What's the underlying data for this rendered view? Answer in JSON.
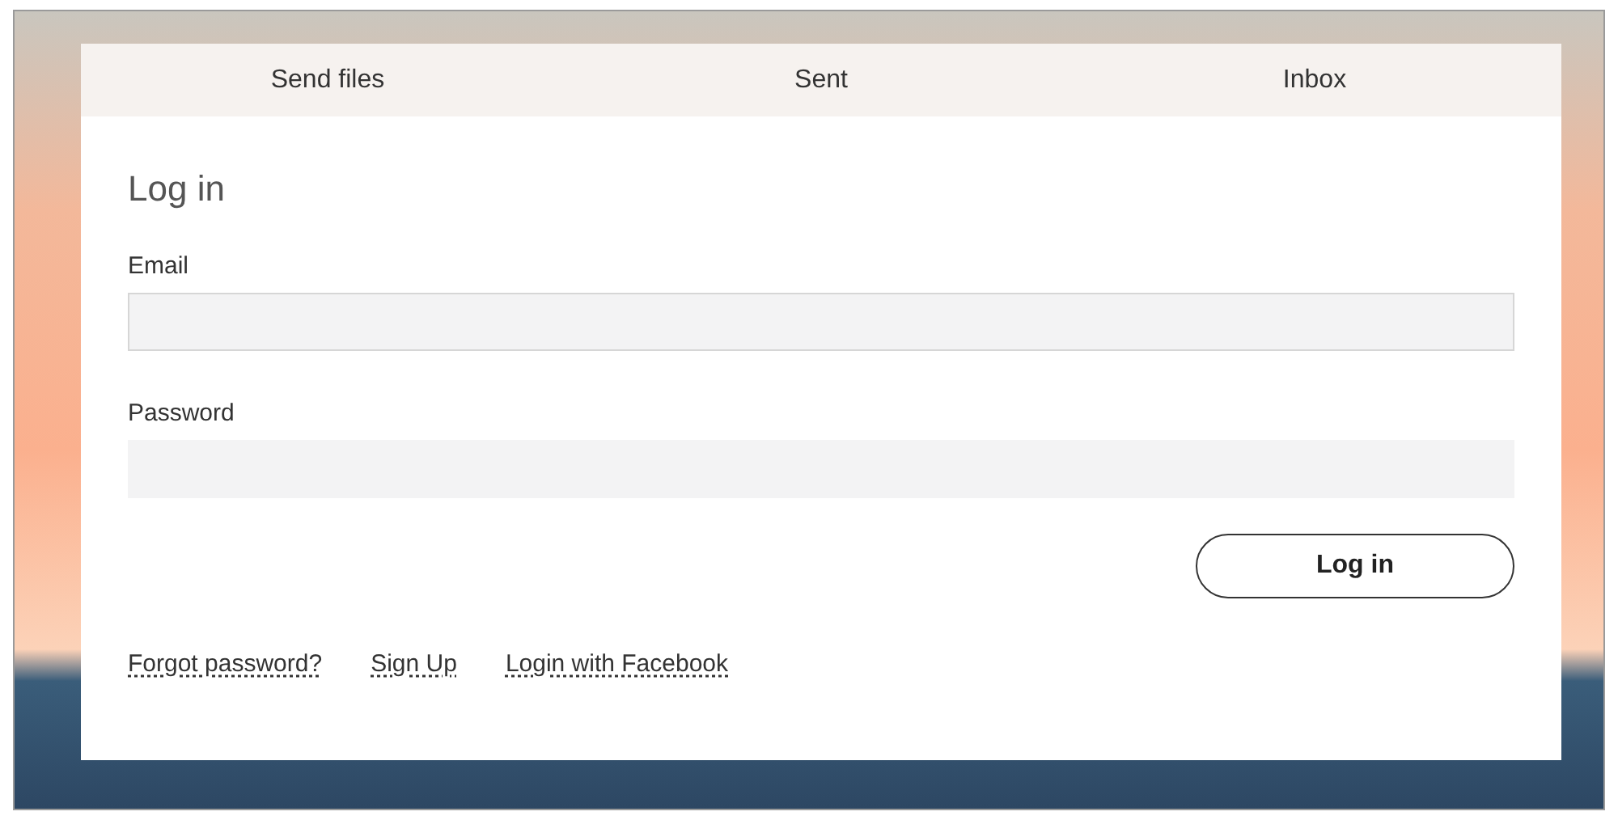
{
  "tabs": [
    {
      "label": "Send files"
    },
    {
      "label": "Sent"
    },
    {
      "label": "Inbox"
    }
  ],
  "form": {
    "title": "Log in",
    "fields": [
      {
        "label": "Email"
      },
      {
        "label": "Password"
      }
    ],
    "submit": "Log in"
  },
  "links": [
    "Forgot password?",
    "Sign Up",
    "Login with Facebook"
  ]
}
